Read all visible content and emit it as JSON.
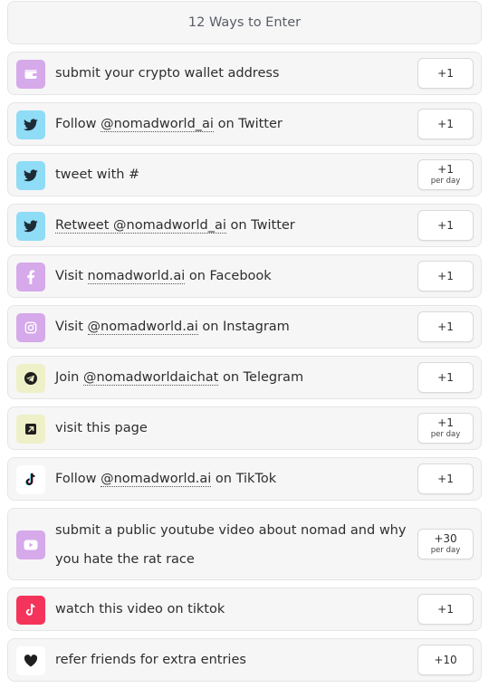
{
  "header": {
    "title": "12 Ways to Enter"
  },
  "colors": {
    "wallet": "#d6a9ea",
    "twitter": "#8fdcf6",
    "facebook": "#d6a9ea",
    "instagram": "#d6a9ea",
    "telegram": "#eef0c8",
    "visit": "#eef0c8",
    "tiktok": "#ffffff",
    "youtube": "#d6a9ea",
    "tiktok_watch": "#f4345a",
    "refer": "#ffffff"
  },
  "entries": [
    {
      "icon": "wallet-icon",
      "parts": [
        "submit your crypto wallet address"
      ],
      "value": "+1",
      "sub": ""
    },
    {
      "icon": "twitter-icon",
      "parts": [
        "Follow ",
        "@nomadworld_ai",
        " on Twitter"
      ],
      "value": "+1",
      "sub": ""
    },
    {
      "icon": "twitter-icon",
      "parts": [
        "tweet with #"
      ],
      "value": "+1",
      "sub": "per day"
    },
    {
      "icon": "twitter-icon",
      "parts": [
        "Retweet @nomadworld_ai",
        " on Twitter"
      ],
      "value": "+1",
      "sub": ""
    },
    {
      "icon": "facebook-icon",
      "parts": [
        "Visit ",
        "nomadworld.ai",
        " on Facebook"
      ],
      "value": "+1",
      "sub": ""
    },
    {
      "icon": "instagram-icon",
      "parts": [
        "Visit ",
        "@nomadworld.ai",
        " on Instagram"
      ],
      "value": "+1",
      "sub": ""
    },
    {
      "icon": "telegram-icon",
      "parts": [
        "Join ",
        "@nomadworldaichat",
        " on Telegram"
      ],
      "value": "+1",
      "sub": ""
    },
    {
      "icon": "external-link-icon",
      "parts": [
        "visit this page"
      ],
      "value": "+1",
      "sub": "per day"
    },
    {
      "icon": "tiktok-icon",
      "parts": [
        "Follow ",
        "@nomadworld.ai",
        " on TikTok"
      ],
      "value": "+1",
      "sub": ""
    },
    {
      "icon": "youtube-icon",
      "parts": [
        "submit a public youtube video about nomad and why you hate the rat race"
      ],
      "value": "+30",
      "sub": "per day"
    },
    {
      "icon": "tiktok-icon",
      "parts": [
        "watch this video on tiktok"
      ],
      "value": "+1",
      "sub": ""
    },
    {
      "icon": "heart-icon",
      "parts": [
        "refer friends for extra entries"
      ],
      "value": "+10",
      "sub": ""
    }
  ]
}
